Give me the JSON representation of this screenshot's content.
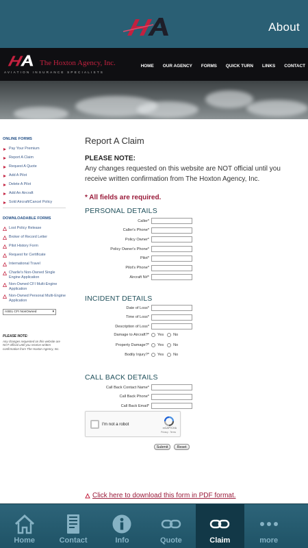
{
  "app_header": {
    "about_label": "About"
  },
  "site": {
    "company": "The Hoxton Agency, Inc.",
    "tagline": "AVIATION INSURANCE SPECIALISTS",
    "nav": [
      "HOME",
      "OUR AGENCY",
      "FORMS",
      "QUICK TURN",
      "LINKS",
      "CONTACT"
    ]
  },
  "sidebar": {
    "online_heading": "ONLINE FORMS",
    "online_forms": [
      "Pay Your Premium",
      "Report A Claim",
      "Request A Quote",
      "Add A Pilot",
      "Delete A Pilot",
      "Add An Aircraft",
      "Sold Aircraft/Cancel Policy"
    ],
    "downloadable_heading": "DOWNLOADABLE FORMS",
    "downloadable_forms": [
      "Lost Policy Release",
      "Broker of Record Letter",
      "Pilot History Form",
      "Request for Certificate",
      "International Travel",
      "Charlie's Non-Owned Single Engine Application",
      "Non-Owned CFI Multi-Engine Application",
      "Non-Owned Personal Multi-Engine Application"
    ],
    "select_value": "ASEL CFI NonOwned",
    "note_title": "PLEASE NOTE:",
    "note_text": "Any changes requested on this website are NOT official until you receive written confirmation from The Hoxton Agency, Inc."
  },
  "main": {
    "title": "Report A Claim",
    "please_note": "PLEASE NOTE:",
    "note_body": "Any changes requested on this website are NOT official until you receive written confirmation from The Hoxton Agency, Inc.",
    "required": "* All fields are required.",
    "personal_title": "PERSONAL DETAILS",
    "personal_fields": [
      "Caller*",
      "Caller's Phone*",
      "Policy Owner*",
      "Policy Owner's Phone*",
      "Pilot*",
      "Pilot's Phone*",
      "Aircraft N#*"
    ],
    "incident_title": "INCIDENT DETAILS",
    "incident_fields": [
      "Date of Loss*",
      "Time of Loss*",
      "Description of Loss*"
    ],
    "incident_radios": [
      "Damage to Aircraft?*",
      "Property Damage?*",
      "Bodily Injury?*"
    ],
    "yes_label": "Yes",
    "no_label": "No",
    "callback_title": "CALL BACK DETAILS",
    "callback_fields": [
      "Call Back Contact Name*",
      "Call Back Phone*",
      "Call Back Email*"
    ],
    "captcha_label": "I'm not a robot",
    "captcha_brand": "reCAPTCHA",
    "captcha_links": "Privacy - Terms",
    "submit_label": "Submit",
    "reset_label": "Reset",
    "pdf_link": "Click here to download this form in PDF format."
  },
  "tabs": [
    {
      "label": "Home",
      "icon": "home-icon"
    },
    {
      "label": "Contact",
      "icon": "contact-icon"
    },
    {
      "label": "Info",
      "icon": "info-icon"
    },
    {
      "label": "Quote",
      "icon": "link-icon"
    },
    {
      "label": "Claim",
      "icon": "link-icon"
    },
    {
      "label": "more",
      "icon": "more-icon"
    }
  ],
  "active_tab": "Claim",
  "colors": {
    "header": "#2a5f74",
    "brand_red": "#c3213f",
    "accent_maroon": "#9a1b3a",
    "section_teal": "#1f4f5a",
    "sidebar_blue": "#234f86"
  }
}
